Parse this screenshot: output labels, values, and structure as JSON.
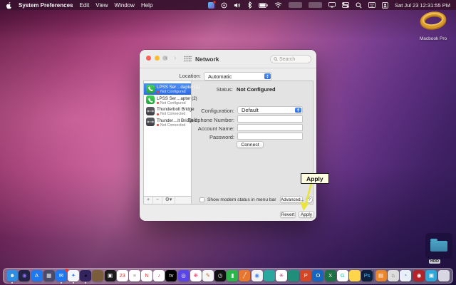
{
  "menubar": {
    "app_name": "System Preferences",
    "items": [
      "Edit",
      "View",
      "Window",
      "Help"
    ],
    "clock": "Sat Jul 23 12:31:55 PM"
  },
  "desktop": {
    "macbook_label": "Macbook Pro",
    "hdd_label": "HDD"
  },
  "window": {
    "title": "Network",
    "search_placeholder": "Search",
    "location_label": "Location:",
    "location_value": "Automatic",
    "status_label": "Status:",
    "status_value": "Not Configured",
    "sidebar": [
      {
        "name": "LPSS Ser…dapter (1)",
        "status": "Not Configured"
      },
      {
        "name": "LPSS Ser…apter (2)",
        "status": "Not Configured"
      },
      {
        "name": "Thunderbolt Bridge",
        "status": "Not Connected"
      },
      {
        "name": "Thunder…lt Bridge 2",
        "status": "Not Connected"
      }
    ],
    "sidebar_actions": {
      "add": "+",
      "remove": "−",
      "gear": "⚙▾"
    },
    "form": {
      "configuration_label": "Configuration:",
      "configuration_value": "Default",
      "telephone_label": "Telephone Number:",
      "telephone_value": "",
      "account_label": "Account Name:",
      "account_value": "",
      "password_label": "Password:",
      "password_value": "",
      "connect_label": "Connect"
    },
    "footer": {
      "checkbox_label": "Show modem status in menu bar",
      "checkbox_checked": false,
      "advanced_label": "Advanced...",
      "help_label": "?",
      "revert_label": "Revert",
      "apply_label": "Apply"
    }
  },
  "callout": {
    "label": "Apply",
    "box_color": "#fffde1",
    "arrow_color": "#e9e53c"
  },
  "colors": {
    "selection_blue": "#3b7df0",
    "status_dot_red": "#e0443a",
    "traffic_red": "#ff5f57",
    "traffic_yellow": "#febc2e",
    "traffic_gray": "#c7c5c3"
  },
  "dock": {
    "items": [
      {
        "name": "finder",
        "color": "#2f8de4",
        "glyph": "☻",
        "gc": "#ffffff",
        "running": true
      },
      {
        "name": "siri",
        "color": "#232347",
        "glyph": "◉",
        "gc": "#8f6ff0"
      },
      {
        "name": "app-store",
        "color": "#1f78f0",
        "glyph": "A",
        "gc": "#ffffff"
      },
      {
        "name": "launchpad",
        "color": "#4a4a6a",
        "glyph": "▦",
        "gc": "#eeeeee"
      },
      {
        "name": "mail",
        "color": "#1f78f0",
        "glyph": "✉",
        "gc": "#ffffff",
        "badge": true,
        "running": true
      },
      {
        "name": "safari",
        "color": "#f3f7fb",
        "glyph": "✦",
        "gc": "#2e7cf6",
        "running": true
      },
      {
        "name": "firefox",
        "color": "#33235e",
        "glyph": "◕",
        "gc": "#ff942",
        "running": true
      },
      {
        "name": "photo-booth",
        "color": "#7a5d3a",
        "glyph": "",
        "gc": "#ffffff"
      },
      {
        "name": "tv",
        "color": "#1a1a1a",
        "glyph": "▣",
        "gc": "#ffffff"
      },
      {
        "name": "calendar",
        "color": "#ffffff",
        "glyph": "23",
        "gc": "#d0342c"
      },
      {
        "name": "reminders",
        "color": "#ffffff",
        "glyph": "≡",
        "gc": "#999999"
      },
      {
        "name": "news",
        "color": "#ffffff",
        "glyph": "N",
        "gc": "#e03a3a"
      },
      {
        "name": "music",
        "color": "#ffffff",
        "glyph": "♪",
        "gc": "#e5395c"
      },
      {
        "name": "tv-plus",
        "color": "#000000",
        "glyph": "tv",
        "gc": "#ffffff"
      },
      {
        "name": "podcasts",
        "color": "#5a46e8",
        "glyph": "◎",
        "gc": "#ffffff"
      },
      {
        "name": "photos",
        "color": "#ffffff",
        "glyph": "❋",
        "gc": "#e8486e"
      },
      {
        "name": "textedit",
        "color": "#f5f5f5",
        "glyph": "✎",
        "gc": "#c06a2a"
      },
      {
        "name": "clock",
        "color": "#111111",
        "glyph": "◷",
        "gc": "#ffffff"
      },
      {
        "name": "stocks",
        "color": "#2bb54a",
        "glyph": "▮",
        "gc": "#ffffff"
      },
      {
        "name": "pencil-app",
        "color": "#e8762e",
        "glyph": "╱",
        "gc": "#ffffff"
      },
      {
        "name": "chrome",
        "color": "#f2f2f2",
        "glyph": "◉",
        "gc": "#4285f4"
      },
      {
        "name": "teal-app",
        "color": "#2aa8a0",
        "glyph": "",
        "gc": "#ffffff"
      },
      {
        "name": "slack",
        "color": "#ffffff",
        "glyph": "✳",
        "gc": "#b0366e"
      },
      {
        "name": "globe-app",
        "color": "#1f8f7a",
        "glyph": "",
        "gc": "#ffffff"
      },
      {
        "name": "powerpoint",
        "color": "#d24726",
        "glyph": "P",
        "gc": "#ffffff"
      },
      {
        "name": "outlook",
        "color": "#1466c0",
        "glyph": "O",
        "gc": "#ffffff"
      },
      {
        "name": "excel",
        "color": "#1e7145",
        "glyph": "X",
        "gc": "#ffffff"
      },
      {
        "name": "grammarly",
        "color": "#ffffff",
        "glyph": "G",
        "gc": "#15c39a"
      },
      {
        "name": "keynote",
        "color": "#ffd54a",
        "glyph": "",
        "gc": "#ffffff"
      },
      {
        "name": "photoshop",
        "color": "#0d1f3c",
        "glyph": "Ps",
        "gc": "#3ec1ff"
      },
      {
        "name": "books",
        "color": "#e8862e",
        "glyph": "▤",
        "gc": "#ffffff",
        "sep": true
      },
      {
        "name": "home",
        "color": "#dcdcdc",
        "glyph": "⌂",
        "gc": "#555555"
      },
      {
        "name": "compass",
        "color": "#e9eff7",
        "glyph": "◔",
        "gc": "#2e7cf6"
      },
      {
        "name": "camera-red",
        "color": "#b5232a",
        "glyph": "◉",
        "gc": "#ffffff",
        "sep": true
      },
      {
        "name": "camera-blue",
        "color": "#2ea8d8",
        "glyph": "▣",
        "gc": "#ffffff"
      },
      {
        "name": "trash",
        "color": "rgba(235,235,242,0.85)",
        "glyph": "",
        "gc": "#888888"
      }
    ]
  }
}
